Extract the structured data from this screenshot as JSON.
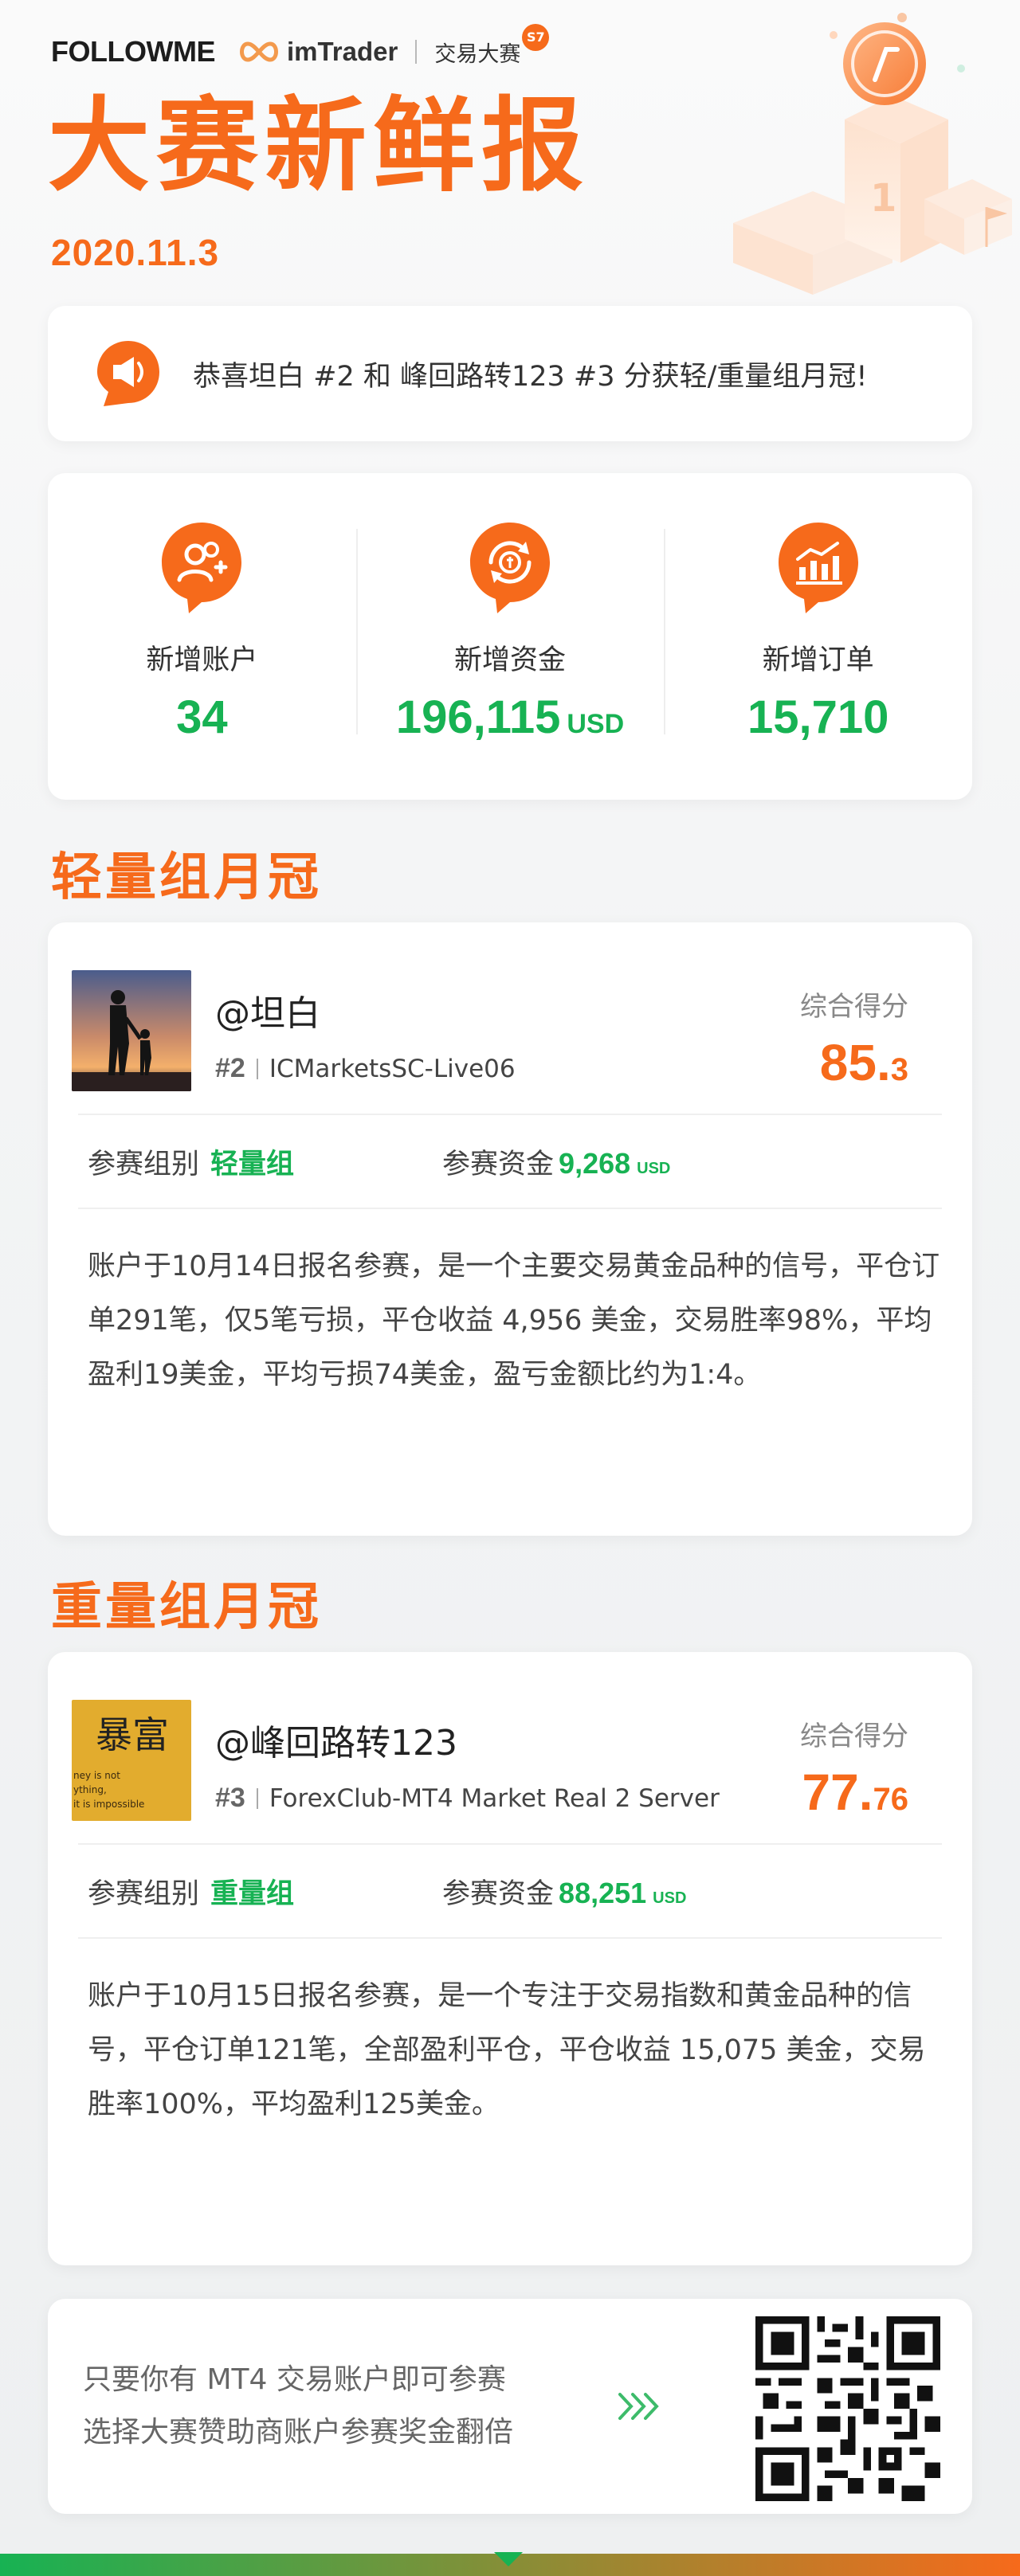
{
  "brand": {
    "followme": "FOLLOWME",
    "imtrader": "imTrader",
    "contest": "交易大赛",
    "season": "S7"
  },
  "title": "大赛新鲜报",
  "date": "2020.11.3",
  "notice": "恭喜坦白 #2 和 峰回路转123 #3 分获轻/重量组月冠!",
  "stats": [
    {
      "label": "新增账户",
      "value": "34",
      "unit": "",
      "icon": "users-icon"
    },
    {
      "label": "新增资金",
      "value": "196,115",
      "unit": "USD",
      "icon": "funds-icon"
    },
    {
      "label": "新增订单",
      "value": "15,710",
      "unit": "",
      "icon": "orders-chart-icon"
    }
  ],
  "sections": {
    "light": "轻量组月冠",
    "heavy": "重量组月冠"
  },
  "winners": [
    {
      "name": "@坦白",
      "rank": "#2",
      "server": "ICMarketsSC-Live06",
      "score_label": "综合得分",
      "score_int": "85.",
      "score_dec": "3",
      "group_label": "参赛组别",
      "group_value": "轻量组",
      "fund_label": "参赛资金",
      "fund_value": "9,268",
      "fund_unit": "USD",
      "description": "账户于10月14日报名参赛，是一个主要交易黄金品种的信号，平仓订单291笔，仅5笔亏损，平仓收益 4,956 美金，交易胜率98%，平均盈利19美金，平均亏损74美金，盈亏金额比约为1:4。"
    },
    {
      "name": "@峰回路转123",
      "rank": "#3",
      "server": "ForexClub-MT4 Market Real 2 Server",
      "score_label": "综合得分",
      "score_int": "77.",
      "score_dec": "76",
      "group_label": "参赛组别",
      "group_value": "重量组",
      "fund_label": "参赛资金",
      "fund_value": "88,251",
      "fund_unit": "USD",
      "avatar_text": "暴富",
      "avatar_small_text": "ney is not\nything,\nit is impossible",
      "description": "账户于10月15日报名参赛，是一个专注于交易指数和黄金品种的信号，平仓订单121笔，全部盈利平仓，平仓收益 15,075 美金，交易胜率100%，平均盈利125美金。"
    }
  ],
  "footer": {
    "line1": "只要你有 MT4 交易账户即可参赛",
    "line2": "选择大赛赞助商账户参赛奖金翻倍"
  },
  "colors": {
    "accent": "#f66a1b",
    "green": "#17b253"
  }
}
